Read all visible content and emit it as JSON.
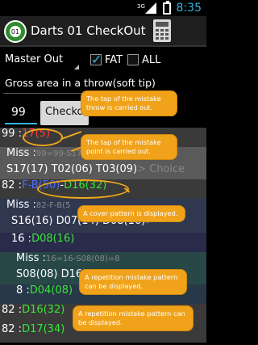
{
  "status_bar": {
    "network": "3G",
    "time": "8:35"
  },
  "action_bar": {
    "title": "Darts 01 CheckOut",
    "logo_text": "01"
  },
  "controls": {
    "mode_select": "Master Out",
    "fat_label": "FAT",
    "fat_checked": true,
    "all_label": "ALL",
    "all_checked": false,
    "gross_label": "Gross area in a throw(soft tip)",
    "score_value": "99",
    "check_button": "Checkout",
    "ghost_text": "Choice"
  },
  "result_lines": [
    {
      "prefix": "99 : ",
      "a": "17(5)",
      "b": ""
    },
    {
      "prefix": "Miss : ",
      "a": "99=99-S17",
      "b": ""
    },
    {
      "prefix": "",
      "a": "S17(17) T02(06) T03(09)",
      "b": " >  Choice"
    },
    {
      "prefix": "82 : ",
      "a": "F-B(50)",
      "b": "D16(32)"
    },
    {
      "prefix": "Miss : ",
      "a": "82-F-B(5",
      "b": ""
    },
    {
      "prefix": "",
      "a": "S16(16) D07(14) D08(16)",
      "b": " >"
    },
    {
      "prefix": "16 : ",
      "a": "D08(16)",
      "b": ""
    },
    {
      "prefix": "Miss : ",
      "a": "16=16-S08(08)=8",
      "b": ""
    },
    {
      "prefix": "",
      "a": "S08(08) D16",
      "b": ""
    },
    {
      "prefix": "8 : ",
      "a": "D04(08)",
      "b": ""
    },
    {
      "prefix": "82 : ",
      "a": "D16(32)",
      "b": ""
    },
    {
      "prefix": "82 : ",
      "a": "D17(34)",
      "b": ""
    }
  ],
  "callouts": [
    "The tap of the mistake throw is carried out.",
    "The tap of the mistake point is carried out.",
    "A cover pattern is displayed.",
    "A repetition mistake pattern can be displayed.",
    "A repetition mistake pattern can be displayed."
  ]
}
